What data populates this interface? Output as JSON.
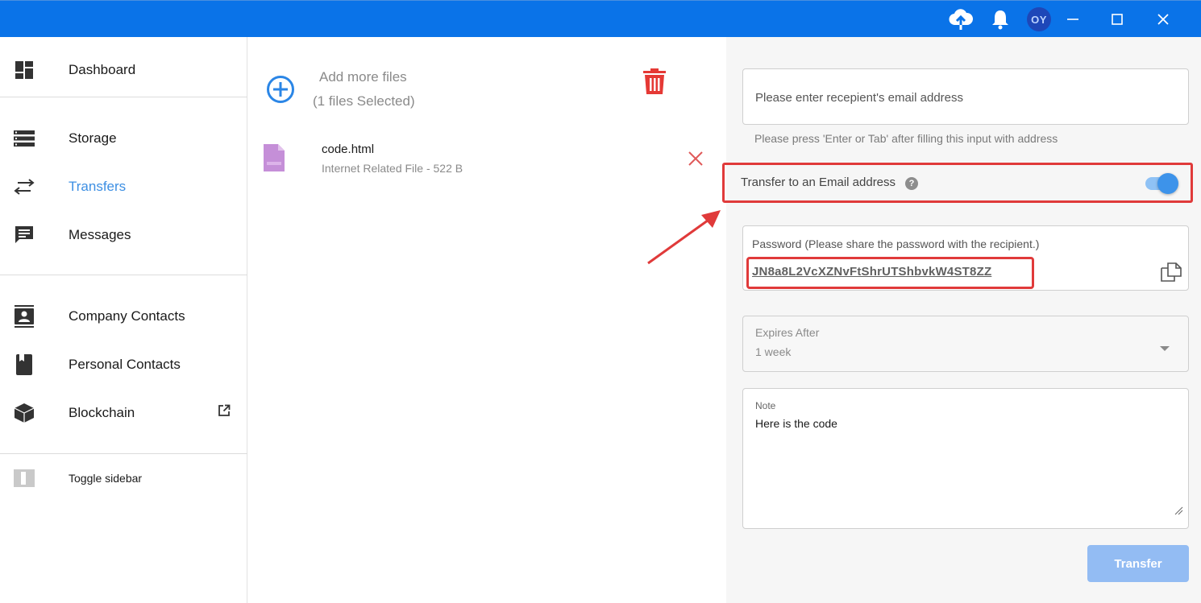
{
  "titlebar": {
    "avatar_initials": "OY",
    "icons": [
      "cloud-upload-icon",
      "bell-icon",
      "minimize-icon",
      "maximize-icon",
      "close-icon"
    ]
  },
  "sidebar": {
    "items": [
      {
        "label": "Dashboard",
        "icon": "dashboard-icon"
      },
      {
        "label": "Storage",
        "icon": "storage-icon"
      },
      {
        "label": "Transfers",
        "icon": "transfers-icon",
        "active": true
      },
      {
        "label": "Messages",
        "icon": "messages-icon"
      },
      {
        "label": "Company Contacts",
        "icon": "company-contacts-icon"
      },
      {
        "label": "Personal Contacts",
        "icon": "personal-contacts-icon"
      },
      {
        "label": "Blockchain",
        "icon": "blockchain-icon"
      }
    ],
    "toggle_label": "Toggle sidebar"
  },
  "files": {
    "add_label": "Add more files",
    "selected_label": "(1 files Selected)",
    "list": [
      {
        "name": "code.html",
        "meta": "Internet Related File - 522 B"
      }
    ]
  },
  "form": {
    "email_placeholder": "Please enter recepient's email address",
    "email_hint": "Please press 'Enter or Tab' after filling this input with address",
    "transfer_email_label": "Transfer to an Email address",
    "transfer_email_enabled": true,
    "password_label": "Password (Please share the password with the recipient.)",
    "password_value": "JN8a8L2VcXZNvFtShrUTShbvkW4ST8ZZ",
    "expires_label": "Expires After",
    "expires_value": "1 week",
    "note_label": "Note",
    "note_value": "Here is the code",
    "transfer_button": "Transfer"
  },
  "colors": {
    "accent": "#0a73e8",
    "highlight": "#e03a3a",
    "active_nav": "#3d8fe3",
    "button": "#93bcf3"
  }
}
